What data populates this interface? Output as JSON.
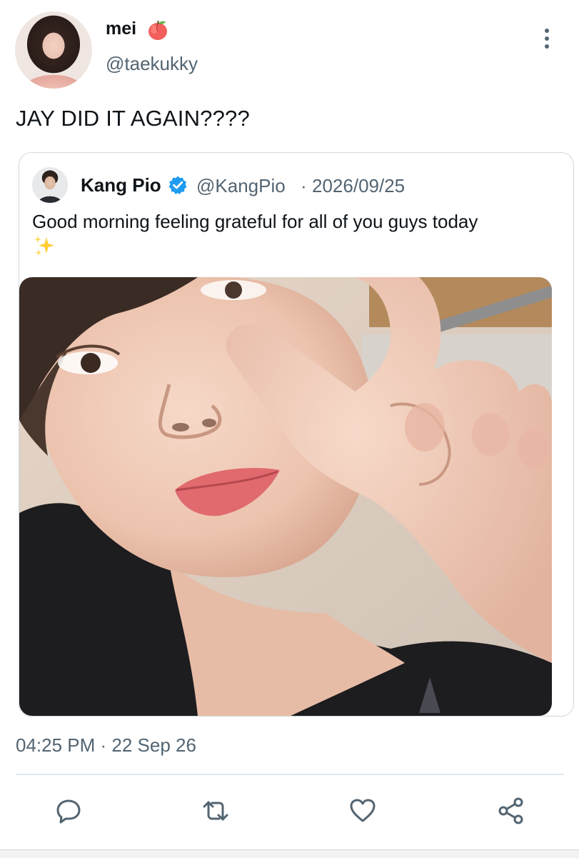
{
  "tweet": {
    "author": {
      "display_name": "mei",
      "name_emoji": "peach-icon",
      "handle": "@taekukky",
      "avatar": "avatar"
    },
    "text": "JAY DID IT AGAIN????",
    "timestamp": "04:25 PM · 22 Sep 26"
  },
  "quoted": {
    "author": {
      "display_name": "Kang Pio",
      "verified": true,
      "handle": "@KangPio",
      "separator": "·",
      "date": "2026/09/25"
    },
    "text": "Good morning feeling grateful for all of you guys today",
    "text_emoji": "sparkles-icon",
    "media": "photo"
  },
  "actions": [
    {
      "name": "reply-icon"
    },
    {
      "name": "retweet-icon"
    },
    {
      "name": "like-icon"
    },
    {
      "name": "share-icon"
    }
  ],
  "colors": {
    "text": "#0f1419",
    "secondary": "#536471",
    "border": "#cfd9de",
    "verified": "#1d9bf0"
  }
}
